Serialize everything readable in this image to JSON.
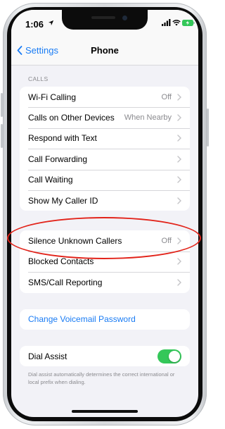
{
  "status_bar": {
    "time": "1:06",
    "icons": [
      "location-arrow-icon",
      "signal-icon",
      "wifi-icon",
      "battery-charging-icon"
    ],
    "battery_color": "#34c759"
  },
  "nav": {
    "back_label": "Settings",
    "title": "Phone",
    "accent": "#1a7cf4"
  },
  "calls_section": {
    "header": "CALLS",
    "items": [
      {
        "label": "Wi-Fi Calling",
        "value": "Off"
      },
      {
        "label": "Calls on Other Devices",
        "value": "When Nearby"
      },
      {
        "label": "Respond with Text",
        "value": ""
      },
      {
        "label": "Call Forwarding",
        "value": ""
      },
      {
        "label": "Call Waiting",
        "value": ""
      },
      {
        "label": "Show My Caller ID",
        "value": ""
      }
    ]
  },
  "blocking_section": {
    "items": [
      {
        "label": "Silence Unknown Callers",
        "value": "Off"
      },
      {
        "label": "Blocked Contacts",
        "value": ""
      },
      {
        "label": "SMS/Call Reporting",
        "value": ""
      }
    ]
  },
  "voicemail": {
    "link_label": "Change Voicemail Password"
  },
  "dial_assist": {
    "label": "Dial Assist",
    "enabled": true,
    "toggle_color": "#34c759",
    "footnote": "Dial assist automatically determines the correct international or local prefix when dialing."
  },
  "annotation": {
    "color": "#e2231a"
  }
}
